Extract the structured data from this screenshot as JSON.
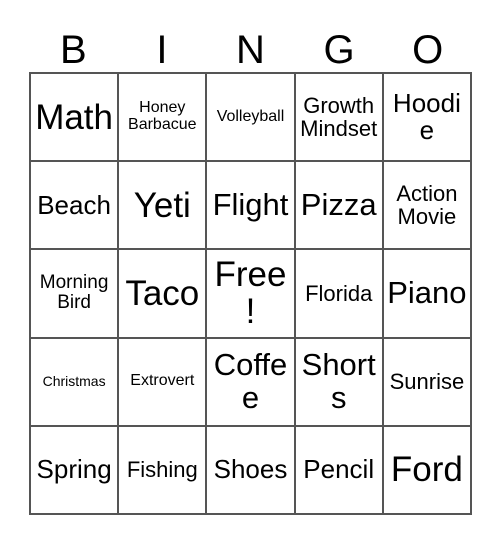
{
  "card": {
    "title_letters": [
      "B",
      "I",
      "N",
      "G",
      "O"
    ],
    "grid_line_color": "#555555",
    "background_color": "#ffffff",
    "text_color": "#000000"
  },
  "grid": {
    "columns": 5,
    "rows": 5,
    "cells": [
      [
        {
          "label": "Math",
          "size": "fs-max"
        },
        {
          "label": "Honey\nBarbacue",
          "size": "fs-sm"
        },
        {
          "label": "Volleyball",
          "size": "fs-sm"
        },
        {
          "label": "Growth\nMindset",
          "size": "fs-lg"
        },
        {
          "label": "Hoodie",
          "size": "fs-xl"
        }
      ],
      [
        {
          "label": "Beach",
          "size": "fs-xl"
        },
        {
          "label": "Yeti",
          "size": "fs-max"
        },
        {
          "label": "Flight",
          "size": "fs-xxl"
        },
        {
          "label": "Pizza",
          "size": "fs-xxl"
        },
        {
          "label": "Action\nMovie",
          "size": "fs-lg"
        }
      ],
      [
        {
          "label": "Morning\nBird",
          "size": "fs-md"
        },
        {
          "label": "Taco",
          "size": "fs-max"
        },
        {
          "label": "Free!",
          "size": "fs-max"
        },
        {
          "label": "Florida",
          "size": "fs-lg"
        },
        {
          "label": "Piano",
          "size": "fs-xxl"
        }
      ],
      [
        {
          "label": "Christmas",
          "size": "fs-xs"
        },
        {
          "label": "Extrovert",
          "size": "fs-sm"
        },
        {
          "label": "Coffee",
          "size": "fs-xxl"
        },
        {
          "label": "Shorts",
          "size": "fs-xxl"
        },
        {
          "label": "Sunrise",
          "size": "fs-lg"
        }
      ],
      [
        {
          "label": "Spring",
          "size": "fs-xl"
        },
        {
          "label": "Fishing",
          "size": "fs-lg"
        },
        {
          "label": "Shoes",
          "size": "fs-xl"
        },
        {
          "label": "Pencil",
          "size": "fs-xl"
        },
        {
          "label": "Ford",
          "size": "fs-max"
        }
      ]
    ]
  }
}
